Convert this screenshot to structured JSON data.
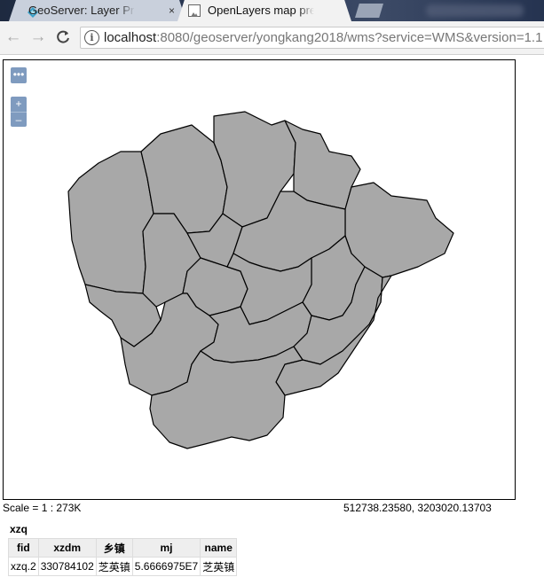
{
  "browser": {
    "tabs": [
      {
        "label": "GeoServer: Layer Previ",
        "close": "×"
      },
      {
        "label": "OpenLayers map previ",
        "close": "×"
      }
    ],
    "url_host": "localhost",
    "url_rest": ":8080/geoserver/yongkang2018/wms?service=WMS&version=1.1"
  },
  "map": {
    "layerswitch_label": "•••",
    "zoom_in": "+",
    "zoom_out": "–",
    "fill_color": "#a8a8a8",
    "stroke_color": "#000000"
  },
  "scale_text": "Scale = 1 : 273K",
  "coords_text": "512738.23580, 3203020.13703",
  "layer_name": "xzq",
  "feature_table": {
    "headers": [
      "fid",
      "xzdm",
      "乡镇",
      "mj",
      "name"
    ],
    "row": [
      "xzq.2",
      "330784102",
      "芝英镇",
      "5.6666975E7",
      "芝英镇"
    ]
  }
}
